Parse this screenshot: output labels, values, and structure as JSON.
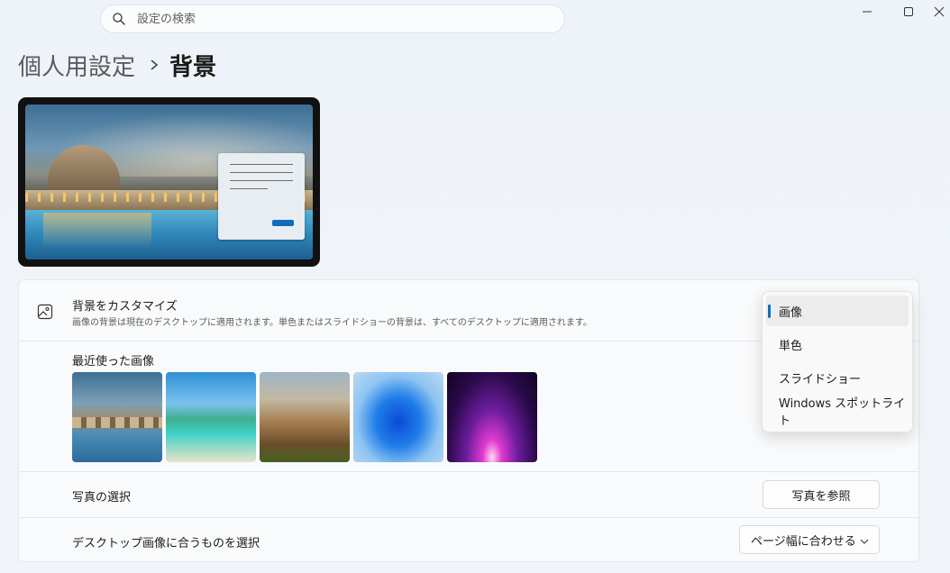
{
  "search": {
    "placeholder": "設定の検索"
  },
  "breadcrumb": {
    "parent": "個人用設定",
    "current": "背景"
  },
  "customize": {
    "title": "背景をカスタマイズ",
    "description": "画像の背景は現在のデスクトップに適用されます。単色またはスライドショーの背景は、すべてのデスクトップに適用されます。"
  },
  "recent": {
    "label": "最近使った画像"
  },
  "photo": {
    "label": "写真の選択",
    "button": "写真を参照"
  },
  "fit": {
    "label": "デスクトップ画像に合うものを選択",
    "value": "ページ幅に合わせる"
  },
  "dropdown": {
    "items": [
      "画像",
      "単色",
      "スライドショー",
      "Windows スポットライト"
    ],
    "selected_index": 0
  },
  "colors": {
    "accent": "#0f6cbd"
  }
}
